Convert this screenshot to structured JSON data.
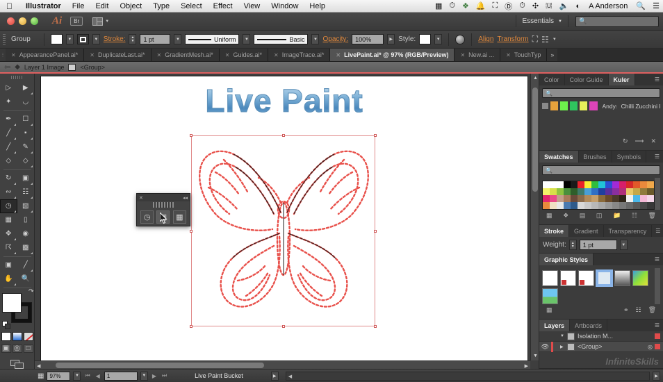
{
  "os_menu": {
    "apple_icon": "apple-icon",
    "items": [
      "Illustrator",
      "File",
      "Edit",
      "Object",
      "Type",
      "Select",
      "Effect",
      "View",
      "Window",
      "Help"
    ],
    "status_icons": [
      "screenshot-icon",
      "clock-icon",
      "dropbox-icon",
      "bell-icon",
      "message-icon",
      "currency-icon",
      "time-machine-icon",
      "bluetooth-icon",
      "flag-icon",
      "volume-icon",
      "spotlight-circle-icon"
    ],
    "user_name": "A Anderson",
    "search_icon": "search-icon",
    "list_icon": "notification-center-icon"
  },
  "titlebar": {
    "app_logo": "Ai",
    "bridge_label": "Br",
    "arrange_icon": "arrange-documents-icon",
    "workspace": "Essentials",
    "search_placeholder": ""
  },
  "control_bar": {
    "selection_label": "Group",
    "fill_icon": "fill-swatch",
    "stroke_icon": "stroke-swatch",
    "stroke_label": "Stroke:",
    "stroke_value": "1 pt",
    "profile_value": "Uniform",
    "brush_value": "Basic",
    "opacity_label": "Opacity:",
    "opacity_value": "100%",
    "style_label": "Style:",
    "align_label": "Align",
    "transform_label": "Transform",
    "isolate_icon": "isolate-group-icon",
    "recolor_icon": "recolor-artwork-icon"
  },
  "tabs": [
    {
      "label": "AppearancePanel.ai*",
      "active": false
    },
    {
      "label": "DuplicateLast.ai*",
      "active": false
    },
    {
      "label": "GradientMesh.ai*",
      "active": false
    },
    {
      "label": "Guides.ai*",
      "active": false
    },
    {
      "label": "ImageTrace.ai*",
      "active": false
    },
    {
      "label": "LivePaint.ai* @ 97% (RGB/Preview)",
      "active": true
    },
    {
      "label": "New.ai ...",
      "active": false
    },
    {
      "label": "TouchTyp",
      "active": false
    }
  ],
  "tab_overflow": "»",
  "breadcrumb": {
    "back_icon": "back-arrow-icon",
    "layers_icon": "layers-stack-icon",
    "layer_label": "Layer 1 Image",
    "group_icon": "group-icon",
    "group_label": "<Group>"
  },
  "toolbox": {
    "tools": [
      [
        "selection-tool",
        "direct-selection-tool"
      ],
      [
        "magic-wand-tool",
        "lasso-tool"
      ],
      [
        "pen-tool",
        "free-transform-tool"
      ],
      [
        "line-segment-tool",
        "rectangle-tool"
      ],
      [
        "paintbrush-tool",
        "pencil-tool"
      ],
      [
        "blob-brush-tool",
        "eraser-tool"
      ],
      [
        "rotate-tool",
        "scale-tool"
      ],
      [
        "width-tool",
        "shape-builder-tool"
      ],
      [
        "live-paint-bucket-tool",
        "perspective-grid-tool"
      ],
      [
        "mesh-tool",
        "gradient-tool"
      ],
      [
        "eyedropper-tool",
        "blend-tool"
      ],
      [
        "symbol-sprayer-tool",
        "column-graph-tool"
      ],
      [
        "artboard-tool",
        "slice-tool"
      ],
      [
        "hand-tool",
        "zoom-tool"
      ]
    ],
    "selected_tool": "live-paint-bucket-tool",
    "fill_color": "#ffffff",
    "stroke_color": "#111111",
    "color_modes": [
      "color-swatch-mode",
      "gradient-mode",
      "none-mode"
    ],
    "draw_modes": [
      "draw-normal-mode",
      "draw-behind-mode",
      "draw-inside-mode"
    ],
    "screen_mode_icon": "change-screen-mode-icon"
  },
  "canvas": {
    "artwork_title": "Live Paint",
    "artwork_name": "butterfly-live-paint-artwork",
    "artwork_stroke_color": "#e8504a",
    "title_gradient_top": "#cfe4f2",
    "title_gradient_bottom": "#4a88bd",
    "selection_border_color": "#e08a8a"
  },
  "mini_panel": {
    "name": "live-paint-gap-options-panel",
    "close_icon": "close-icon",
    "collapse_icon": "collapse-icon",
    "buttons": [
      "merge-live-paint-icon",
      "expand-live-paint-icon",
      "release-live-paint-icon"
    ],
    "hovered_button_index": 1
  },
  "panels": {
    "color_group": {
      "tabs": [
        "Color",
        "Color Guide",
        "Kuler"
      ],
      "active": "Kuler",
      "menu_icon": "panel-menu-icon",
      "search_placeholder": "",
      "theme_author": "Andys",
      "theme_name": "Chilli Zucchini P...",
      "theme_colors": [
        "#e6a23c",
        "#6ef24c",
        "#2fc45e",
        "#e8ef5a",
        "#dd44b8"
      ],
      "footer_icons": [
        "refresh-icon",
        "add-theme-icon",
        "edit-theme-icon"
      ]
    },
    "swatches_group": {
      "tabs": [
        "Swatches",
        "Brushes",
        "Symbols"
      ],
      "active": "Swatches",
      "menu_icon": "panel-menu-icon",
      "search_placeholder": "",
      "rows": [
        [
          "#ffffff",
          "#ffffff",
          "#ffffff",
          "#000000",
          "#1a1a1a",
          "#e8222a",
          "#f7ed33",
          "#2fbd3d",
          "#22c2d6",
          "#2b4fd4",
          "#a22ad6",
          "#d61f6a",
          "#d6282a",
          "#e2592a",
          "#ea8a3c",
          "#f0a84a"
        ],
        [
          "#f4f26a",
          "#d8e04a",
          "#8fc43f",
          "#4a8f3c",
          "#2e5e2a",
          "#3f7a6a",
          "#4a9ed6",
          "#2f6fc4",
          "#1f3f9e",
          "#5a2f9e",
          "#8a2f9e",
          "#b02f7a",
          "#e8c96a",
          "#c4a84a",
          "#8f7a3c",
          "#6a5a2a"
        ],
        [
          "#e0256e",
          "#e84a8a",
          "#c49e8a",
          "#a87a5a",
          "#6a4a3a",
          "#8a6a4a",
          "#b08a5a",
          "#c49e6a",
          "#8a6a3a",
          "#6a4a2a",
          "#4a3a2a",
          "#2e2418",
          "#f0f0f0",
          "#4ab8ea",
          "#f4b8d6",
          "#f4d6e8"
        ],
        [
          "#e88a3c",
          "#f0e0c4",
          "#e8e8e8",
          "#4a7ab0",
          "#2f5a8a",
          "#d8d8d8",
          "#c8c8c8",
          "#b8b8b8",
          "#a8a8a8",
          "#989898",
          "#888888",
          "#787878",
          "#686868",
          "#585858",
          "#484848",
          "#383838"
        ]
      ],
      "footer_icons": [
        "swatch-libraries-icon",
        "color-group-icon",
        "show-swatch-kinds-icon",
        "swatch-options-icon",
        "new-color-group-icon",
        "new-swatch-icon",
        "delete-swatch-icon"
      ]
    },
    "stroke_group": {
      "tabs": [
        "Stroke",
        "Gradient",
        "Transparency"
      ],
      "active": "Stroke",
      "menu_icon": "panel-menu-icon",
      "weight_label": "Weight:",
      "weight_value": "1 pt"
    },
    "graphic_styles": {
      "title": "Graphic Styles",
      "menu_icon": "panel-menu-icon",
      "items": [
        "default-style",
        "none-fill-style",
        "none-stroke-style",
        "blue-border-style",
        "gray-gradient-style",
        "blue-swirl-style",
        "landscape-style"
      ],
      "selected_index": 3,
      "footer_icons": [
        "style-libraries-icon",
        "break-link-icon",
        "new-style-icon",
        "delete-style-icon"
      ]
    },
    "layers_group": {
      "tabs": [
        "Layers",
        "Artboards"
      ],
      "active": "Layers",
      "menu_icon": "panel-menu-icon",
      "rows": [
        {
          "name": "Isolation M...",
          "visible": false,
          "expanded": true,
          "selected": false,
          "color": "#e04b4b"
        },
        {
          "name": "<Group>",
          "visible": true,
          "expanded": false,
          "selected": true,
          "color": "#e04b4b"
        }
      ]
    }
  },
  "status_bar": {
    "artboard_icon": "artboard-navigation-icon",
    "zoom_value": "97%",
    "page_value": "1",
    "tool_name": "Live Paint Bucket",
    "first_icon": "first-artboard-icon",
    "prev_icon": "previous-artboard-icon",
    "next_icon": "next-artboard-icon",
    "last_icon": "last-artboard-icon"
  },
  "watermark": "InfiniteSkills"
}
